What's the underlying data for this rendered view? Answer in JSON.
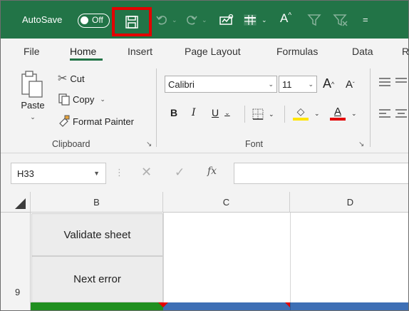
{
  "title_bar": {
    "autosave_label": "AutoSave",
    "autosave_state": "Off",
    "icons": [
      "save-icon",
      "undo-icon",
      "redo-icon",
      "number-format-icon",
      "format-as-table-icon",
      "increase-font-icon",
      "filter-icon",
      "clear-filter-icon",
      "customize-quick-access-icon"
    ]
  },
  "tabs": [
    {
      "label": "File"
    },
    {
      "label": "Home",
      "active": true
    },
    {
      "label": "Insert"
    },
    {
      "label": "Page Layout"
    },
    {
      "label": "Formulas"
    },
    {
      "label": "Data"
    },
    {
      "label": "R"
    }
  ],
  "clipboard": {
    "paste": "Paste",
    "cut": "Cut",
    "copy": "Copy",
    "format_painter": "Format Painter",
    "group_label": "Clipboard"
  },
  "font": {
    "family": "Calibri",
    "size": "11",
    "grow": "A",
    "shrink": "A",
    "bold": "B",
    "italic": "I",
    "underline": "U",
    "font_color_letter": "A",
    "group_label": "Font"
  },
  "formula_bar": {
    "name_box": "H33",
    "fx": "fx",
    "formula": ""
  },
  "grid": {
    "columns": [
      "B",
      "C",
      "D"
    ],
    "row_number": "9",
    "buttons": [
      "Validate sheet",
      "Next error"
    ]
  },
  "colors": {
    "title_bar": "#227447",
    "highlight": "#e30000",
    "green_cell": "#1f8f1f",
    "blue_cell": "#3e6fb5",
    "font_color": "#e30000",
    "fill_color": "#ffe500"
  }
}
